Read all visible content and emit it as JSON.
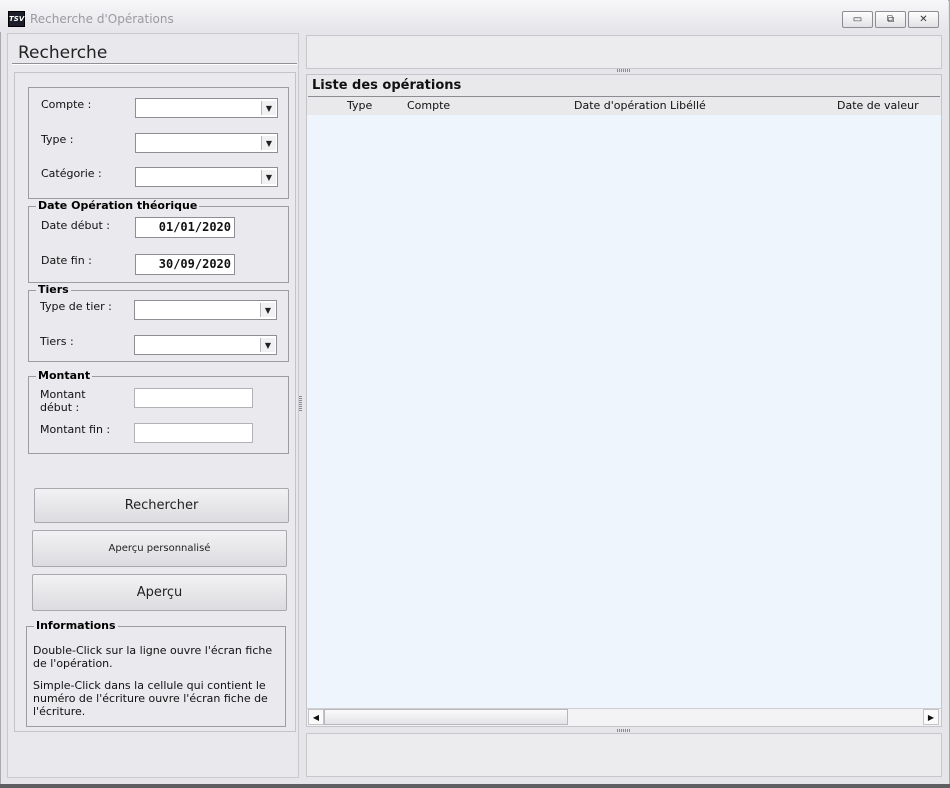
{
  "window": {
    "title": "Recherche d'Opérations",
    "app_icon_text": "TSV",
    "buttons": {
      "minimize": "▭",
      "restore": "⧉",
      "close": "✕"
    }
  },
  "search": {
    "heading": "Recherche",
    "compte_label": "Compte :",
    "compte_value": "",
    "type_label": "Type :",
    "type_value": "",
    "categorie_label": "Catégorie :",
    "categorie_value": "",
    "date_group_title": "Date Opération théorique",
    "date_debut_label": "Date début :",
    "date_debut_value": "01/01/2020",
    "date_fin_label": "Date fin :",
    "date_fin_value": "30/09/2020",
    "tiers_group_title": "Tiers",
    "type_tier_label": "Type de tier :",
    "type_tier_value": "",
    "tiers_label": "Tiers :",
    "tiers_value": "",
    "montant_group_title": "Montant",
    "montant_debut_label_1": "Montant",
    "montant_debut_label_2": "début :",
    "montant_debut_value": "",
    "montant_fin_label": "Montant fin :",
    "montant_fin_value": ""
  },
  "actions": {
    "rechercher": "Rechercher",
    "apercu_perso": "Aperçu personnalisé",
    "apercu": "Aperçu"
  },
  "info": {
    "title": "Informations",
    "line1": "Double-Click sur la ligne ouvre l'écran fiche de l'opération.",
    "line2": "Simple-Click dans la cellule qui contient le numéro de l'écriture ouvre l'écran fiche de l'écriture."
  },
  "list": {
    "title": "Liste des opérations",
    "columns": [
      "Type",
      "Compte",
      "Date d'opération",
      "Libéllé",
      "Date de valeur"
    ],
    "rows": []
  },
  "icons": {
    "dropdown": "▼",
    "scroll_left": "◀",
    "scroll_right": "▶"
  }
}
